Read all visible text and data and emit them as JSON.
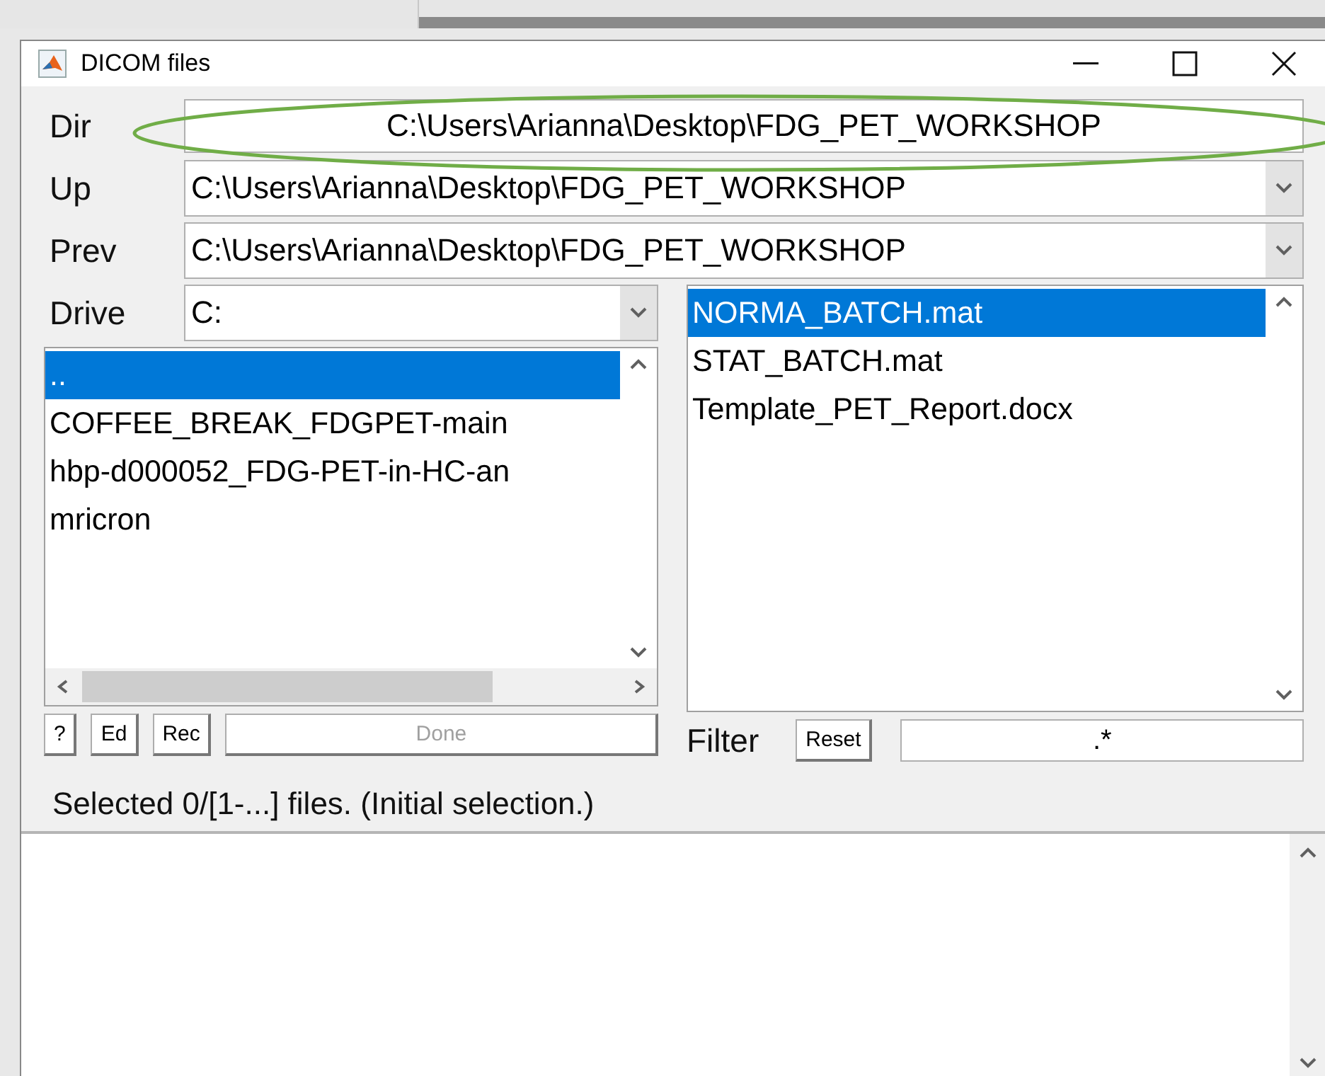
{
  "window": {
    "title": "DICOM files"
  },
  "dir": {
    "label": "Dir",
    "value": "C:\\Users\\Arianna\\Desktop\\FDG_PET_WORKSHOP"
  },
  "up": {
    "label": "Up",
    "value": "C:\\Users\\Arianna\\Desktop\\FDG_PET_WORKSHOP"
  },
  "prev": {
    "label": "Prev",
    "value": "C:\\Users\\Arianna\\Desktop\\FDG_PET_WORKSHOP"
  },
  "drive": {
    "label": "Drive",
    "value": "C:"
  },
  "folders": [
    {
      "label": "..",
      "selected": true
    },
    {
      "label": "COFFEE_BREAK_FDGPET-main",
      "selected": false
    },
    {
      "label": "hbp-d000052_FDG-PET-in-HC-an",
      "selected": false
    },
    {
      "label": "mricron",
      "selected": false
    }
  ],
  "files": [
    {
      "label": "NORMA_BATCH.mat",
      "selected": true
    },
    {
      "label": "STAT_BATCH.mat",
      "selected": false
    },
    {
      "label": "Template_PET_Report.docx",
      "selected": false
    }
  ],
  "buttons": [
    {
      "label": "?",
      "disabled": false
    },
    {
      "label": "Ed",
      "disabled": false
    },
    {
      "label": "Rec",
      "disabled": false
    },
    {
      "label": "Done",
      "disabled": true
    }
  ],
  "filter": {
    "label": "Filter",
    "reset": "Reset",
    "value": ".*"
  },
  "status": "Selected 0/[1-...] files. (Initial selection.)"
}
